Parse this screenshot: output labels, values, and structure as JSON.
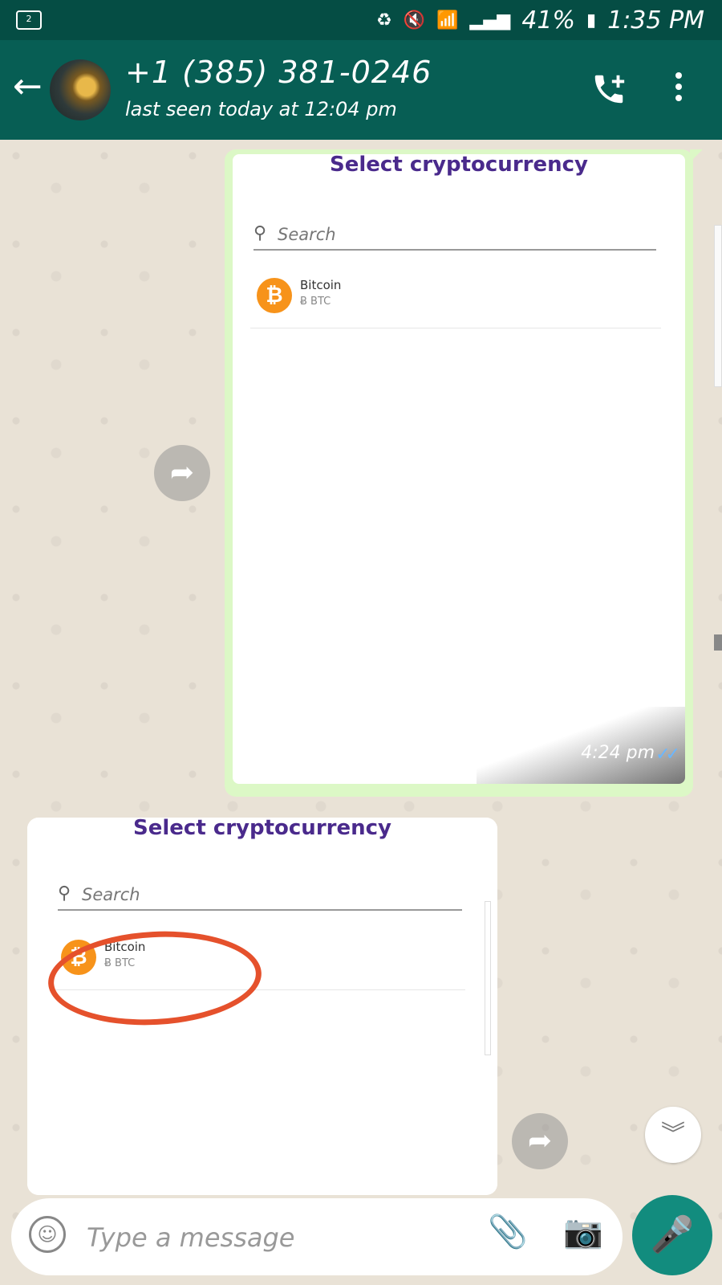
{
  "status_bar": {
    "voicemail_badge": "2",
    "battery_percent": "41%",
    "time": "1:35 PM"
  },
  "app_bar": {
    "contact_name": "+1 (385) 381-0246",
    "last_seen": "last seen today at 12:04 pm",
    "back_icon": "arrow-left-icon",
    "call_icon": "add-call-icon",
    "menu_icon": "more-vert-icon"
  },
  "messages": {
    "outgoing": {
      "title": "Select cryptocurrency",
      "search_placeholder": "Search",
      "coin_name": "Bitcoin",
      "coin_symbol": "Ƀ BTC",
      "coin_glyph": "₿",
      "time": "4:24 pm",
      "ticks": "✓✓"
    },
    "incoming": {
      "title": "Select cryptocurrency",
      "search_placeholder": "Search",
      "coin_name": "Bitcoin",
      "coin_symbol": "Ƀ BTC",
      "coin_glyph": "₿"
    }
  },
  "composer": {
    "placeholder": "Type a message",
    "emoji_icon": "emoji-icon",
    "attach_icon": "paperclip-icon",
    "camera_icon": "camera-icon",
    "mic_icon": "mic-icon"
  },
  "colors": {
    "header": "#075e54",
    "status_bar": "#054d44",
    "outgoing_bubble": "#dcf8c6",
    "accent": "#128c7e",
    "bitcoin": "#f7931a",
    "annotation": "#e5512c",
    "title_purple": "#4a2a8c"
  }
}
